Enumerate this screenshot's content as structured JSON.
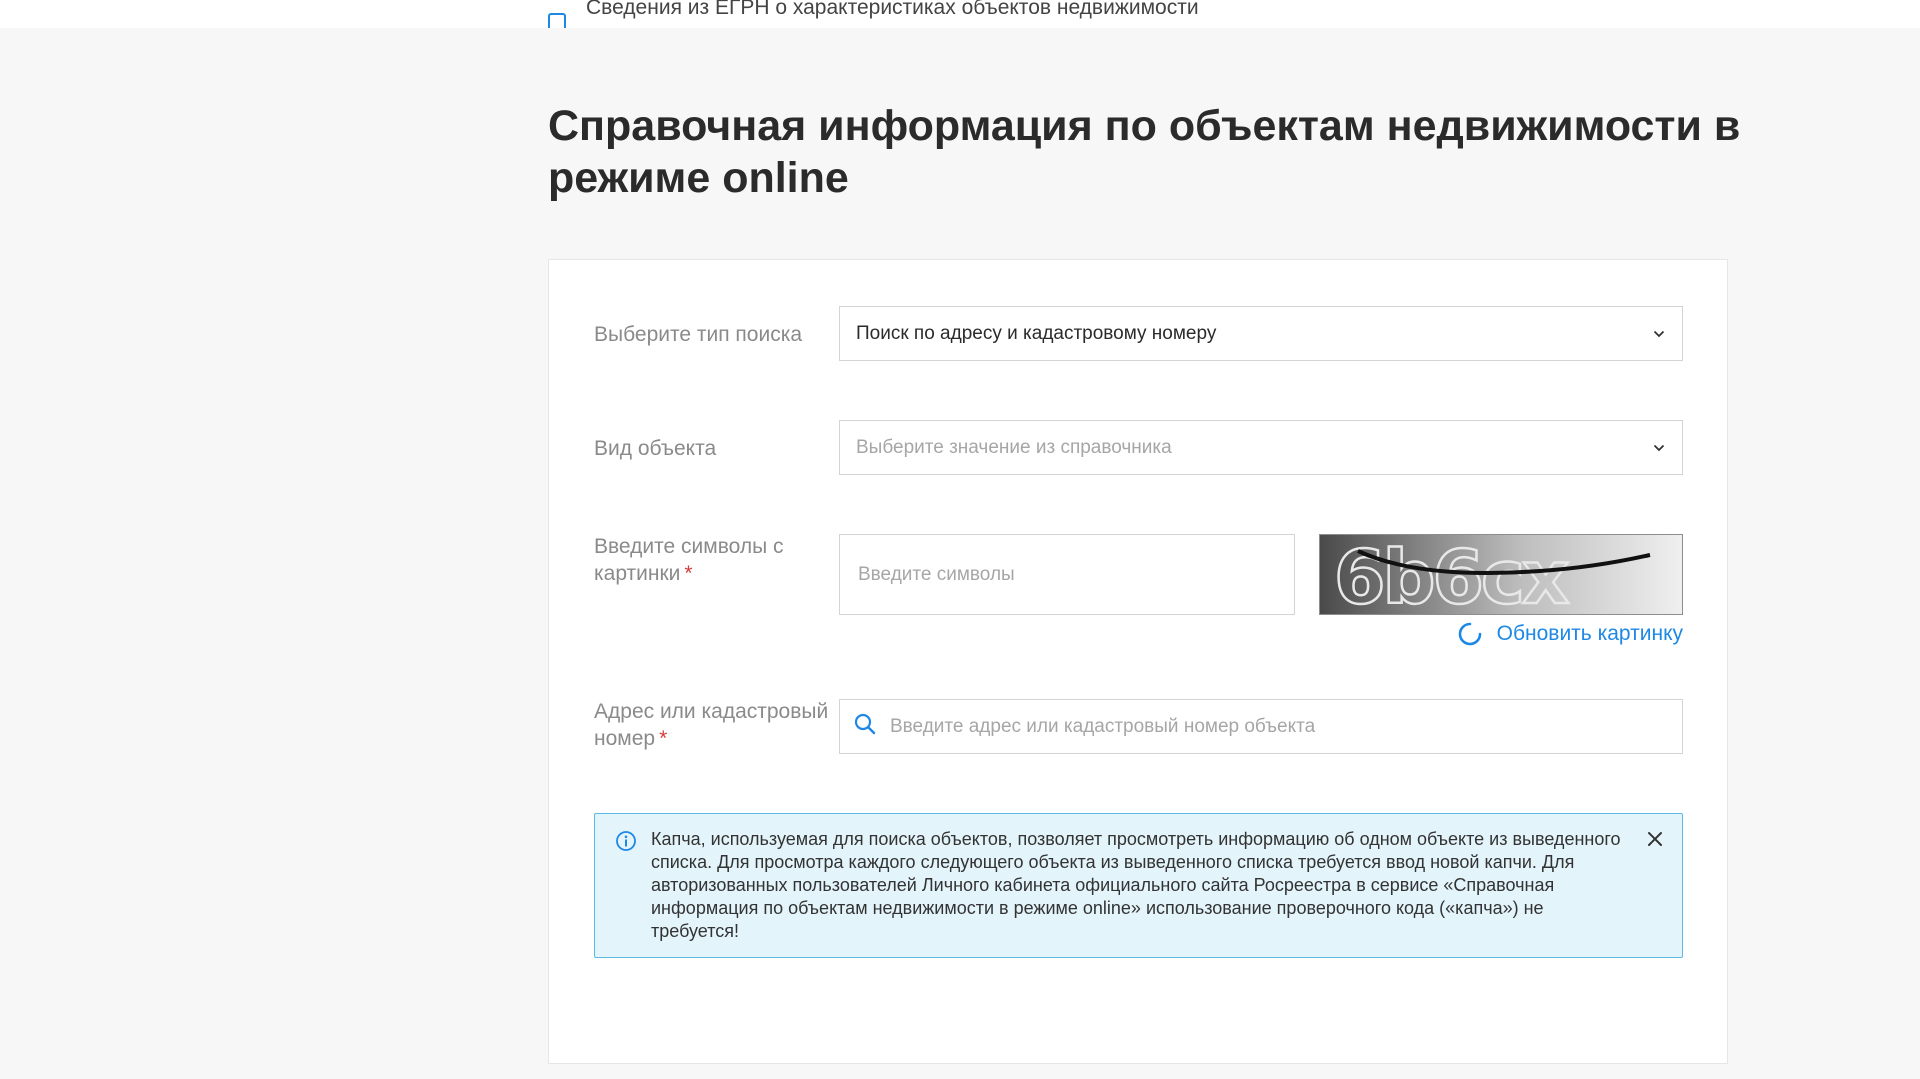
{
  "topbar": {
    "clipped_text": "Сведения из ЕГРН о характеристиках объектов недвижимости"
  },
  "page": {
    "title": "Справочная информация по объектам недвижимости в режиме online"
  },
  "form": {
    "search_type": {
      "label": "Выберите тип поиска",
      "value": "Поиск по адресу и кадастровому номеру",
      "icon": "chevron-down-icon"
    },
    "object_type": {
      "label": "Вид объекта",
      "placeholder": "Выберите значение из справочника",
      "icon": "chevron-down-icon"
    },
    "captcha": {
      "label": "Введите символы с картинки",
      "required_mark": "*",
      "placeholder": "Введите символы",
      "image_text": "6b6cx",
      "refresh_label": "Обновить картинку",
      "refresh_icon": "refresh-icon"
    },
    "address": {
      "label": "Адрес или кадастровый номер",
      "required_mark": "*",
      "placeholder": "Введите адрес или кадастровый номер объекта",
      "icon": "search-icon"
    }
  },
  "info": {
    "icon": "info-icon",
    "text": "Капча, используемая для поиска объектов, позволяет просмотреть информацию об одном объекте из выведенного списка. Для просмотра каждого следующего объекта из выведенного списка требуется ввод новой капчи. Для авторизованных пользователей Личного кабинета официального сайта Росреестра в сервисе «Справочная информация по объектам недвижимости в режиме online» использование проверочного кода («капча») не требуется!",
    "close_icon": "close-icon"
  },
  "colors": {
    "accent": "#1e88e5",
    "required": "#d63b3b",
    "info_bg": "#e3f4fb",
    "info_border": "#5cb8e4",
    "page_bg": "#f7f7f7"
  }
}
